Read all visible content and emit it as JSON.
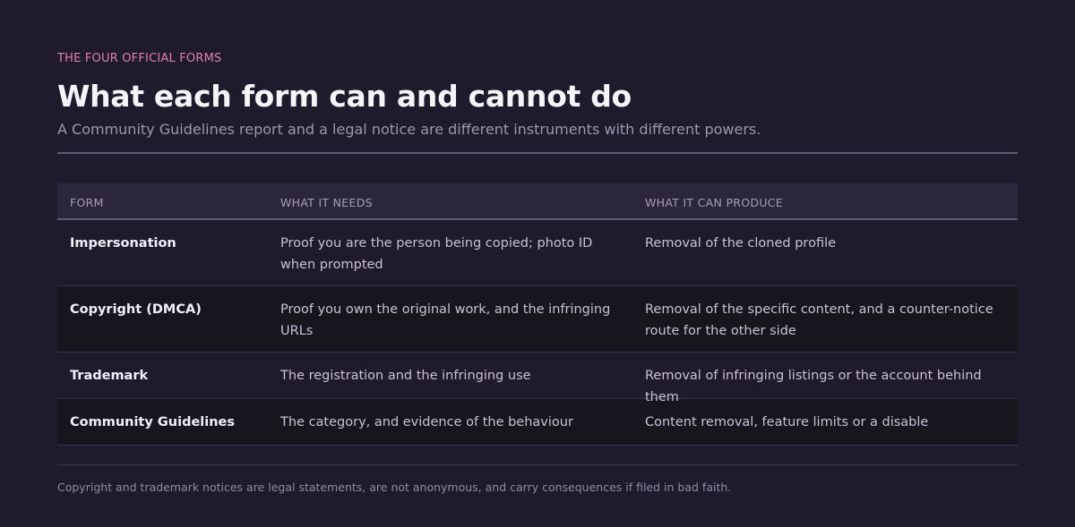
{
  "eyebrow": "THE FOUR OFFICIAL FORMS",
  "title": "What each form can and cannot do",
  "subtitle": "A Community Guidelines report and a legal notice are different instruments with different powers.",
  "table": {
    "headers": [
      "FORM",
      "WHAT IT NEEDS",
      "WHAT IT CAN PRODUCE"
    ],
    "rows": [
      {
        "form": "Impersonation",
        "needs": "Proof you are the person being copied; photo ID when prompted",
        "produces": "Removal of the cloned profile"
      },
      {
        "form": "Copyright (DMCA)",
        "needs": "Proof you own the original work, and the infringing URLs",
        "produces": "Removal of the specific content, and a counter-notice route for the other side"
      },
      {
        "form": "Trademark",
        "needs": "The registration and the infringing use",
        "produces": "Removal of infringing listings or the account behind them"
      },
      {
        "form": "Community Guidelines",
        "needs": "The category, and evidence of the behaviour",
        "produces": "Content removal, feature limits or a disable"
      }
    ]
  },
  "footnote": "Copyright and trademark notices are legal statements, are not anonymous, and carry consequences if filed in bad faith.",
  "colors": {
    "background": "#1f1b2d",
    "accent": "#e27fb3",
    "header_row": "#2c263d",
    "alt_row": "#18151f"
  }
}
